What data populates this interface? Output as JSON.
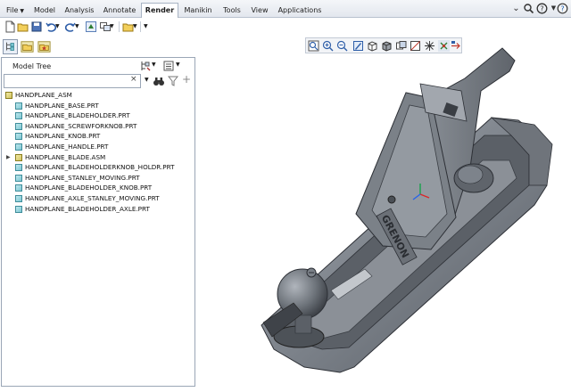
{
  "ribbon": {
    "tabs": [
      {
        "label": "File",
        "dropdown": true,
        "active": false
      },
      {
        "label": "Model",
        "active": false
      },
      {
        "label": "Analysis",
        "active": false
      },
      {
        "label": "Annotate",
        "active": false
      },
      {
        "label": "Render",
        "active": true
      },
      {
        "label": "Manikin",
        "active": false
      },
      {
        "label": "Tools",
        "active": false
      },
      {
        "label": "View",
        "active": false
      },
      {
        "label": "Applications",
        "active": false
      }
    ]
  },
  "model_tree": {
    "title": "Model Tree",
    "search": {
      "value": "",
      "clear_glyph": "×"
    },
    "items": [
      {
        "label": "HANDPLANE_ASM",
        "type": "asm",
        "level": 0,
        "expandable": false
      },
      {
        "label": "HANDPLANE_BASE.PRT",
        "type": "part",
        "level": 1,
        "expandable": false
      },
      {
        "label": "HANDPLANE_BLADEHOLDER.PRT",
        "type": "part",
        "level": 1,
        "expandable": false
      },
      {
        "label": "HANDPLANE_SCREWFORKNOB.PRT",
        "type": "part",
        "level": 1,
        "expandable": false
      },
      {
        "label": "HANDPLANE_KNOB.PRT",
        "type": "part",
        "level": 1,
        "expandable": false
      },
      {
        "label": "HANDPLANE_HANDLE.PRT",
        "type": "part",
        "level": 1,
        "expandable": false
      },
      {
        "label": "HANDPLANE_BLADE.ASM",
        "type": "asm",
        "level": 1,
        "expandable": true
      },
      {
        "label": "HANDPLANE_BLADEHOLDERKNOB_HOLDR.PRT",
        "type": "part",
        "level": 1,
        "expandable": false
      },
      {
        "label": "HANDPLANE_STANLEY_MOVING.PRT",
        "type": "part",
        "level": 1,
        "expandable": false
      },
      {
        "label": "HANDPLANE_BLADEHOLDER_KNOB.PRT",
        "type": "part",
        "level": 1,
        "expandable": false
      },
      {
        "label": "HANDPLANE_AXLE_STANLEY_MOVING.PRT",
        "type": "part",
        "level": 1,
        "expandable": false
      },
      {
        "label": "HANDPLANE_BLADEHOLDER_AXLE.PRT",
        "type": "part",
        "level": 1,
        "expandable": false
      }
    ]
  },
  "viewport": {
    "embossed_text": "GRENON"
  },
  "colors": {
    "accent": "#2a6fc9",
    "model_body": "#7f848b",
    "part_icon": "#7cc7d3",
    "asm_icon": "#d1c462"
  }
}
